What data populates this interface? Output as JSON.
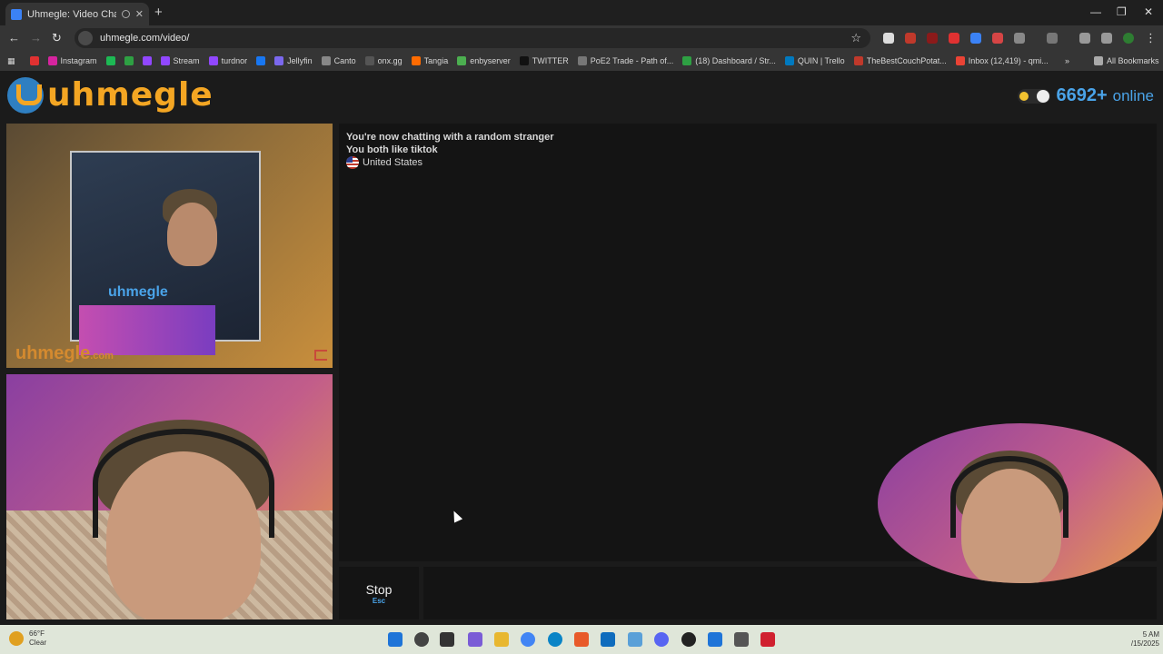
{
  "browser": {
    "tab_title": "Uhmegle: Video Chat | Ome",
    "url": "uhmegle.com/video/",
    "bookmarks": [
      {
        "label": "",
        "color": "#e03131"
      },
      {
        "label": "Instagram",
        "color": "#d6249f"
      },
      {
        "label": "",
        "color": "#1db954"
      },
      {
        "label": "",
        "color": "#2ea043"
      },
      {
        "label": "",
        "color": "#9147ff"
      },
      {
        "label": "Stream",
        "color": "#9147ff"
      },
      {
        "label": "turdnor",
        "color": "#9147ff"
      },
      {
        "label": "",
        "color": "#1877f2"
      },
      {
        "label": "Jellyfin",
        "color": "#7b68ee"
      },
      {
        "label": "Canto",
        "color": "#888888"
      },
      {
        "label": "onx.gg",
        "color": "#555555"
      },
      {
        "label": "Tangia",
        "color": "#ff6b00"
      },
      {
        "label": "enbyserver",
        "color": "#4caf50"
      },
      {
        "label": "TWITTER",
        "color": "#111111"
      },
      {
        "label": "PoE2 Trade - Path of...",
        "color": "#777777"
      },
      {
        "label": "(18) Dashboard / Str...",
        "color": "#2ea043"
      },
      {
        "label": "QUIN | Trello",
        "color": "#0079bf"
      },
      {
        "label": "TheBestCouchPotat...",
        "color": "#c0392b"
      },
      {
        "label": "Inbox (12,419) - qmi...",
        "color": "#ea4335"
      }
    ],
    "all_bookmarks": "All Bookmarks"
  },
  "site": {
    "logo_text": "uhmegle",
    "online_count": "6692+",
    "online_label": "online",
    "video_watermark": "uhmegle",
    "video_watermark_suffix": ".com",
    "inner_watermark": "uhmegle"
  },
  "chat": {
    "status_line": "You're now chatting with a random stranger",
    "interest_line": "You both like tiktok",
    "country": "United States"
  },
  "controls": {
    "stop_label": "Stop",
    "stop_key": "Esc"
  },
  "taskbar": {
    "temperature": "66°F",
    "condition": "Clear",
    "time": "5 AM",
    "date": "/15/2025"
  }
}
